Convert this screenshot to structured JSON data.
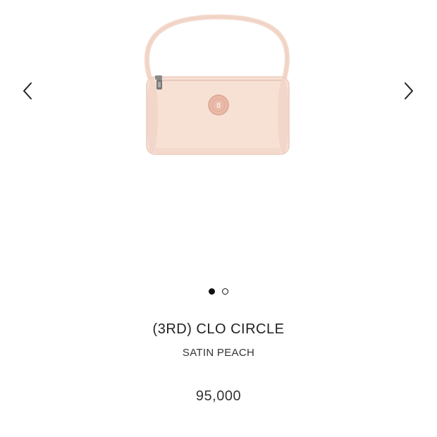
{
  "carousel": {
    "prev_icon": "chevron-left-icon",
    "next_icon": "chevron-right-icon",
    "slide_count": 2,
    "active_slide": 1
  },
  "product": {
    "name": "(3RD) CLO CIRCLE",
    "variant": "SATIN PEACH",
    "price": "95,000",
    "color": "#f6ddd1"
  }
}
